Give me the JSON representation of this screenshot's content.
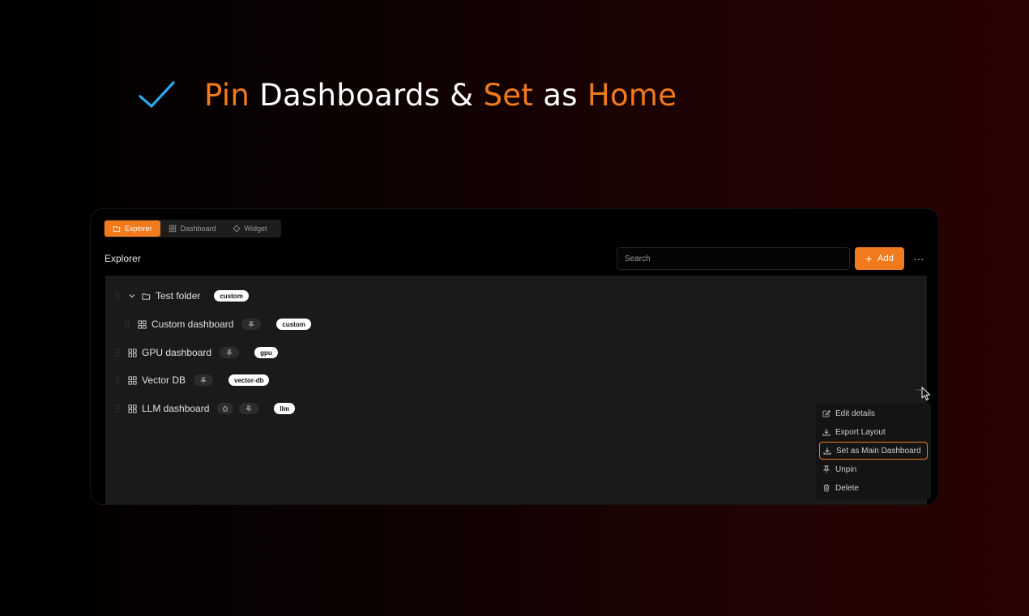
{
  "headline": {
    "words": [
      {
        "text": "Pin",
        "accent": true
      },
      {
        "text": " Dashboards & ",
        "accent": false
      },
      {
        "text": "Set",
        "accent": true
      },
      {
        "text": " as ",
        "accent": false
      },
      {
        "text": "Home",
        "accent": true
      }
    ],
    "icon": "checkmark-icon"
  },
  "colors": {
    "accent": "#f07a1c",
    "check": "#2aa8f0",
    "tag_bg": "#ffffff"
  },
  "tabs": [
    {
      "label": "Explorer",
      "icon": "folder-icon",
      "active": true
    },
    {
      "label": "Dashboard",
      "icon": "grid-icon",
      "active": false
    },
    {
      "label": "Widget",
      "icon": "widget-icon",
      "active": false
    }
  ],
  "explorer": {
    "title": "Explorer",
    "search_placeholder": "Search",
    "add_label": "Add",
    "more_label": "···"
  },
  "tree": [
    {
      "label": "Test folder",
      "type": "folder",
      "expanded": true,
      "tag": "custom"
    },
    {
      "label": "Custom dashboard",
      "type": "dashboard",
      "pinned": true,
      "tag": "custom"
    },
    {
      "label": "GPU dashboard",
      "type": "dashboard",
      "pinned": true,
      "tag": "gpu"
    },
    {
      "label": "Vector DB",
      "type": "dashboard",
      "pinned": true,
      "tag": "vector-db"
    },
    {
      "label": "LLM dashboard",
      "type": "dashboard",
      "home": true,
      "pinned": true,
      "tag": "llm"
    }
  ],
  "context_menu": [
    {
      "label": "Edit details",
      "icon": "edit-icon"
    },
    {
      "label": "Export Layout",
      "icon": "download-icon"
    },
    {
      "label": "Set as Main Dashboard",
      "icon": "download-icon",
      "highlighted": true
    },
    {
      "label": "Unpin",
      "icon": "pin-icon"
    },
    {
      "label": "Delete",
      "icon": "trash-icon"
    }
  ]
}
